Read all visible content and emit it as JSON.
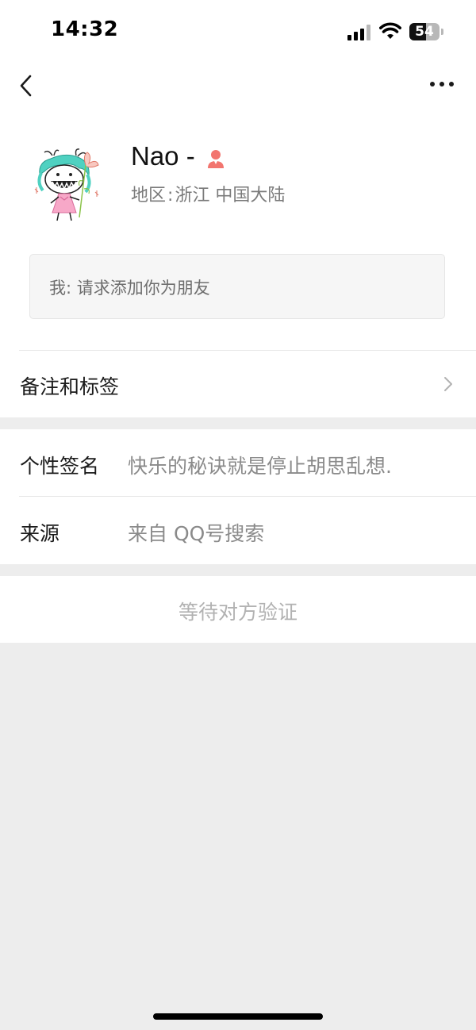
{
  "status_bar": {
    "time": "14:32",
    "battery": 54,
    "battery_text": "54"
  },
  "nav": {
    "back_icon": "back-arrow-icon",
    "more_icon": "more-dots-icon"
  },
  "profile": {
    "nickname": "Nao -",
    "gender_icon": "female-icon",
    "region_label": "地区",
    "region_sep": ":",
    "region_value": "浙江 中国大陆",
    "request_message": "我: 请求添加你为朋友",
    "remark_label": "备注和标签"
  },
  "info": {
    "signature_label": "个性签名",
    "signature_value": "快乐的秘诀就是停止胡思乱想.",
    "source_label": "来源",
    "source_value": "来自 QQ号搜索"
  },
  "action": {
    "waiting_label": "等待对方验证"
  },
  "colors": {
    "page_background": "#ededed",
    "card_background": "#ffffff",
    "gender_female": "#f2756f",
    "secondary_text": "#8a8a8a",
    "disabled_text": "#b2b2b2"
  }
}
